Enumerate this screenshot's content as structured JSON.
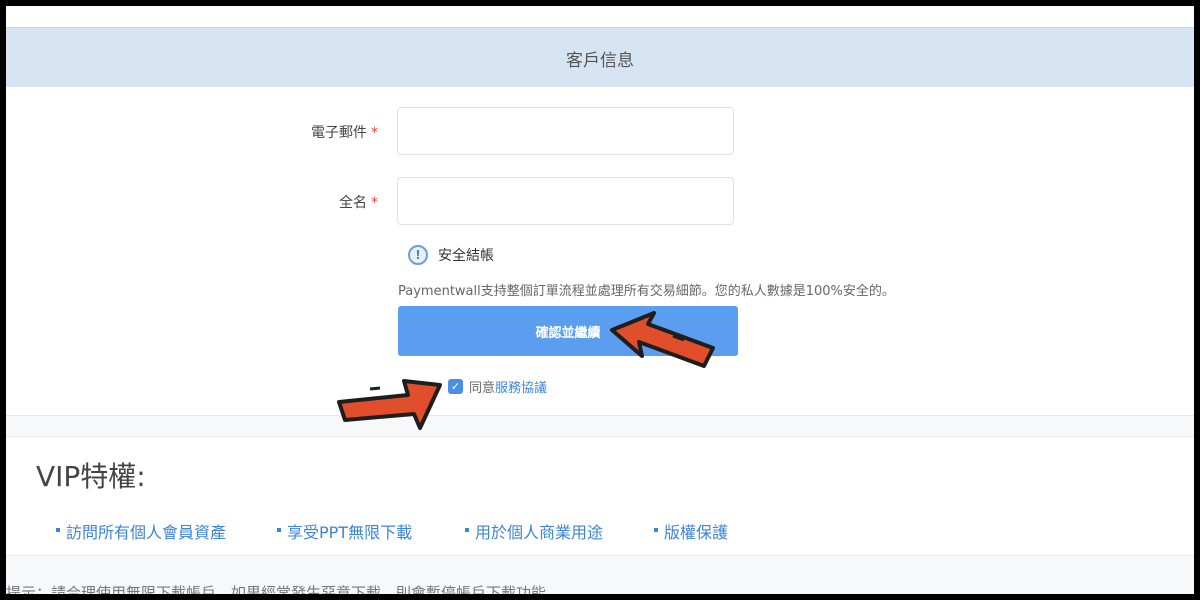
{
  "header": {
    "title": "客戶信息"
  },
  "form": {
    "email_label": "電子郵件",
    "fullname_label": "全名",
    "required_mark": "*",
    "email_value": "",
    "fullname_value": ""
  },
  "secure": {
    "icon": "info-icon",
    "icon_glyph": "!",
    "title": "安全結帳",
    "description": "Paymentwall支持整個訂單流程並處理所有交易細節。您的私人數據是100%安全的。"
  },
  "confirm_button": {
    "label": "確認並繼續"
  },
  "agreement": {
    "checked": true,
    "prefix": "同意",
    "link": "服務協議"
  },
  "vip": {
    "title": "VIP特權:",
    "items": [
      "訪問所有個人會員資產",
      "享受PPT無限下載",
      "用於個人商業用途",
      "版權保護"
    ]
  },
  "tip": {
    "text": "提示：請合理使用無限下載帳戶。如果經常發生惡意下載，則會暫停帳戶下載功能。"
  },
  "colors": {
    "accent": "#5b9ef0",
    "header_bg": "#d6e4f3",
    "arrow": "#e04e2c",
    "required": "#e0473c"
  }
}
